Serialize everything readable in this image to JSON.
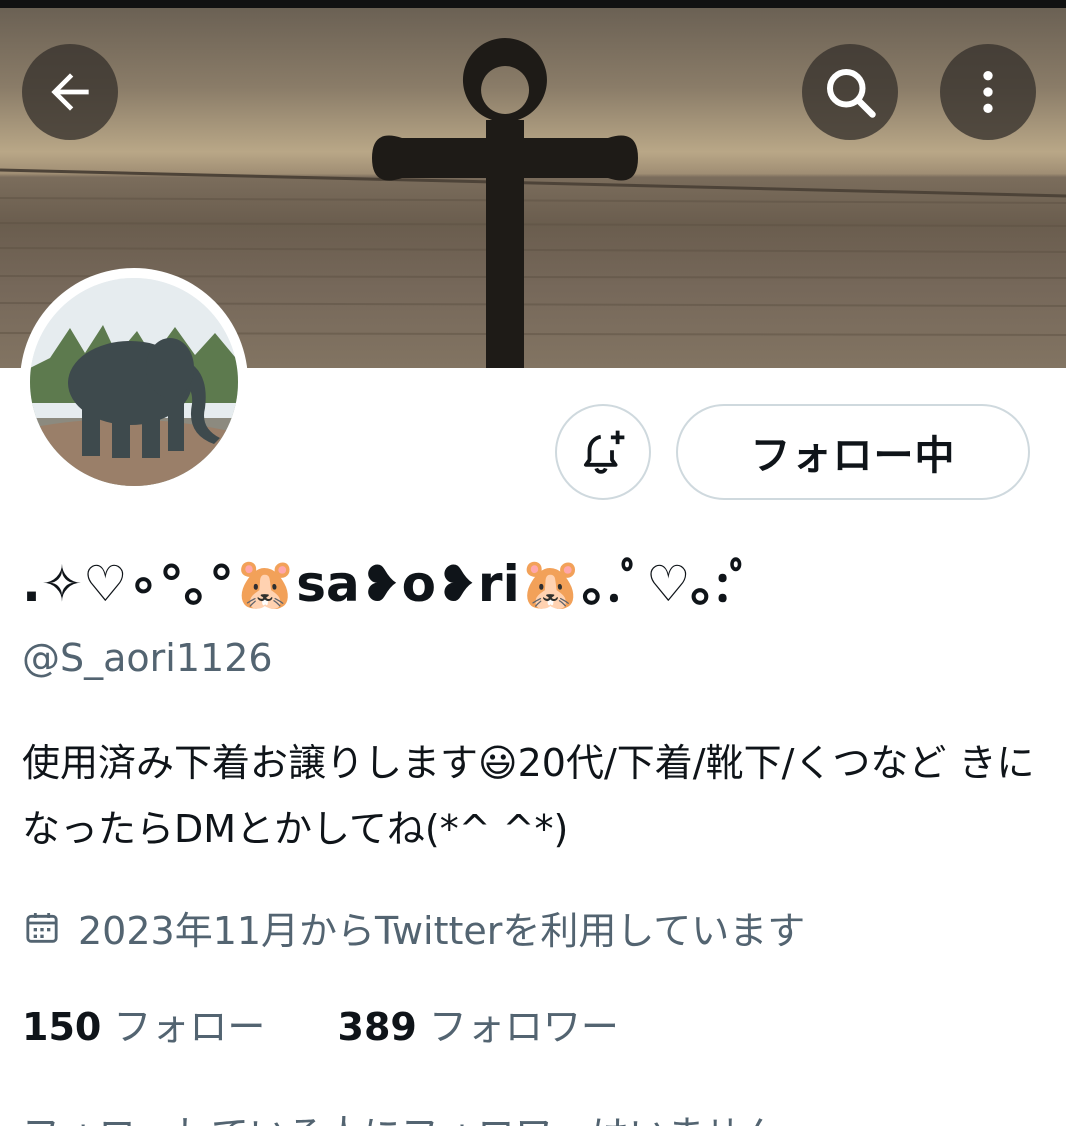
{
  "profile": {
    "display_name": ".✧♡∘°｡°🐹sa❥o❥ri🐹｡.ﾟ♡｡:ﾟ",
    "handle": "@S_aori1126",
    "bio": "使用済み下着お譲りします😃20代/下着/靴下/くつなど きになったらDMとかしてね(*^ ^*)",
    "joined": "2023年11月からTwitterを利用しています",
    "following_count": "150",
    "following_label": "フォロー",
    "followers_count": "389",
    "followers_label": "フォロワー",
    "truncated_line": "フォローしている人にフォロワーはいません"
  },
  "actions": {
    "follow_button_label": "フォロー中"
  },
  "icons": {
    "back": "arrow-left-icon",
    "search": "search-icon",
    "more": "more-vertical-icon",
    "notify": "bell-plus-icon",
    "calendar": "calendar-icon"
  },
  "colors": {
    "text_primary": "#0f1419",
    "text_secondary": "#536471",
    "border": "#cfd9de"
  }
}
